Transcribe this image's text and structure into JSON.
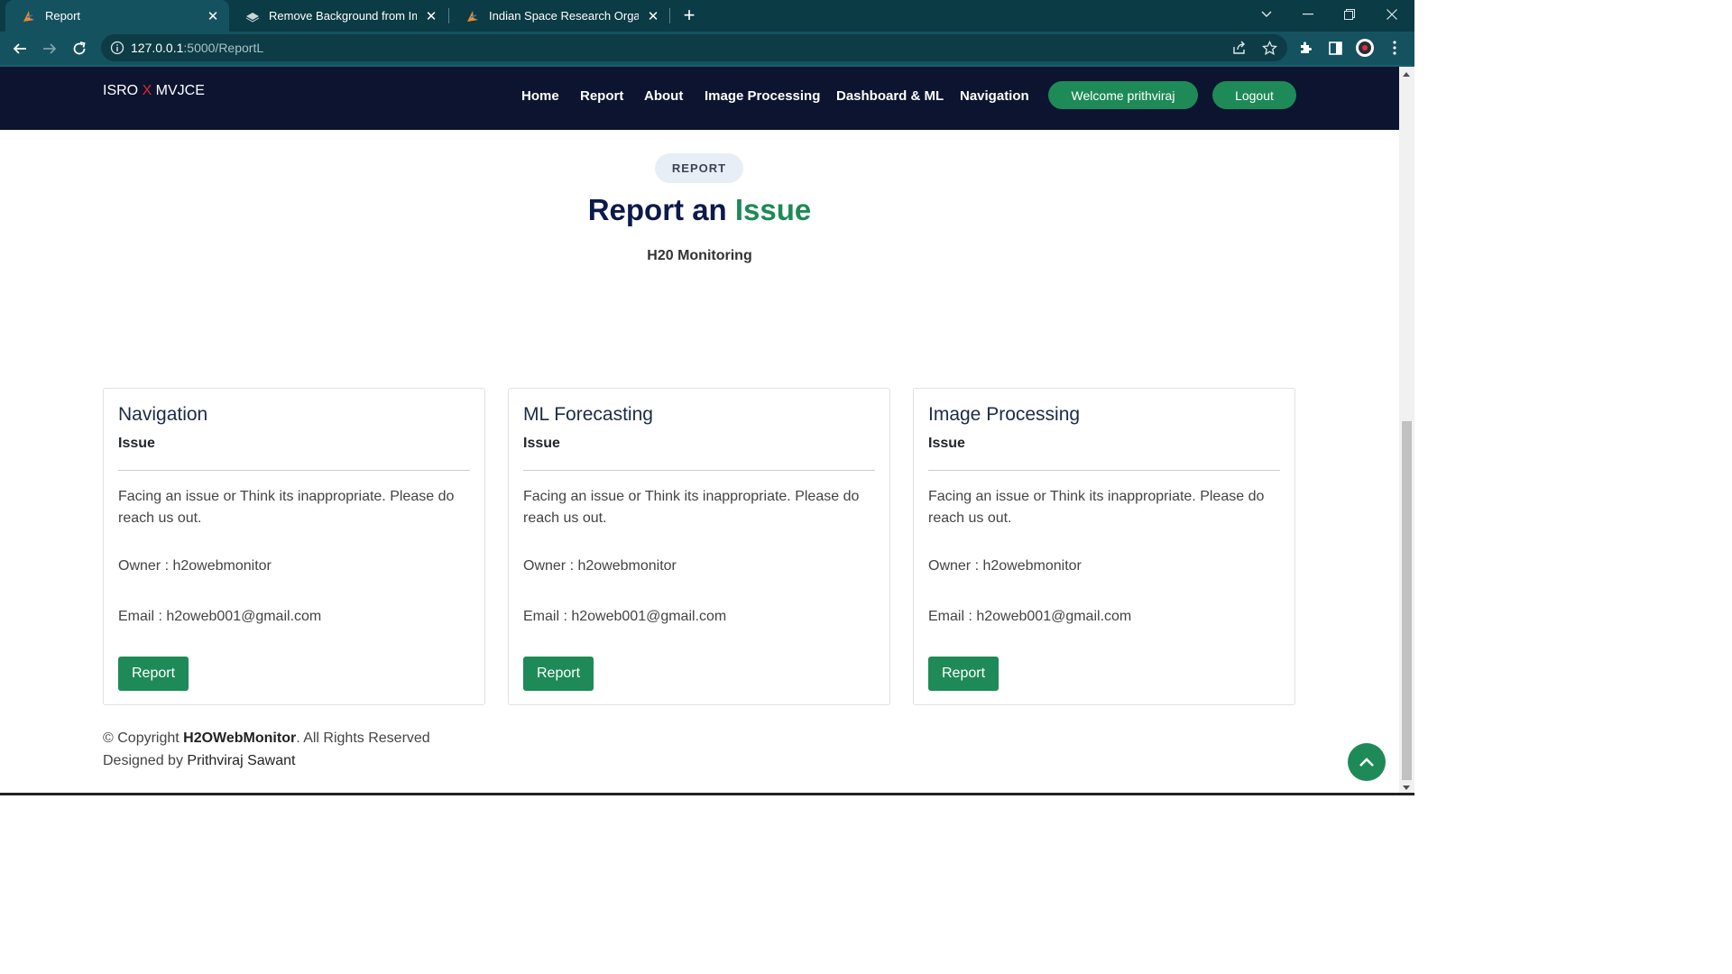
{
  "browser": {
    "tabs": [
      {
        "title": "Report",
        "active": true
      },
      {
        "title": "Remove Background from Image",
        "active": false
      },
      {
        "title": "Indian Space Research Organisati",
        "active": false
      }
    ],
    "url_host": "127.0.0.1",
    "url_path": ":5000/ReportL"
  },
  "header": {
    "logo_left": "ISRO ",
    "logo_x": "X",
    "logo_right": " MVJCE",
    "nav": [
      "Home",
      "Report",
      "About",
      "Image Processing",
      "Dashboard & ML",
      "Navigation"
    ],
    "welcome": "Welcome prithviraj",
    "logout": "Logout"
  },
  "section": {
    "badge": "REPORT",
    "title_main": "Report an ",
    "title_accent": "Issue",
    "subtitle": "H20 Monitoring"
  },
  "cards": [
    {
      "title": "Navigation",
      "subtitle": "Issue",
      "text": "Facing an issue or Think its inappropriate. Please do reach us out.",
      "owner": "Owner : h2owebmonitor",
      "email": "Email : h2oweb001@gmail.com",
      "button": "Report"
    },
    {
      "title": "ML Forecasting",
      "subtitle": "Issue",
      "text": "Facing an issue or Think its inappropriate. Please do reach us out.",
      "owner": "Owner : h2owebmonitor",
      "email": "Email : h2oweb001@gmail.com",
      "button": "Report"
    },
    {
      "title": "Image Processing",
      "subtitle": "Issue",
      "text": "Facing an issue or Think its inappropriate. Please do reach us out.",
      "owner": "Owner : h2owebmonitor",
      "email": "Email : h2oweb001@gmail.com",
      "button": "Report"
    }
  ],
  "footer": {
    "copyright_prefix": "© Copyright ",
    "brand": "H2OWebMonitor",
    "copyright_suffix": ". All Rights Reserved",
    "designed_prefix": "Designed by ",
    "designer": "Prithviraj Sawant"
  },
  "colors": {
    "accent_green": "#1e8a57",
    "header_navy": "#0c1430",
    "logo_x_red": "#e0262b",
    "title_navy": "#0c1a4a"
  },
  "icons": [
    "back-arrow-icon",
    "forward-arrow-icon",
    "reload-icon",
    "info-icon",
    "share-icon",
    "star-icon",
    "extensions-icon",
    "sidepanel-icon",
    "profile-icon",
    "menu-dots-icon",
    "chevron-up-icon"
  ]
}
